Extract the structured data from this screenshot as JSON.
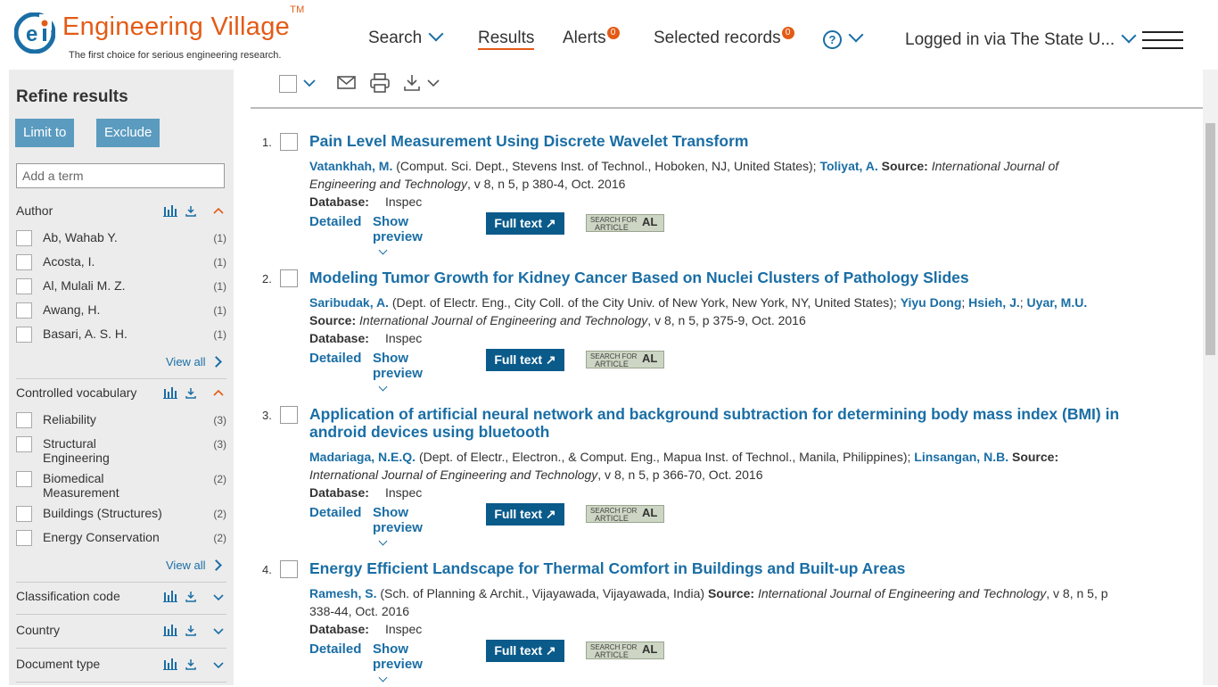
{
  "header": {
    "brand": "Engineering Village",
    "trademark": "TM",
    "tagline": "The first choice for serious engineering research.",
    "nav": {
      "search": "Search",
      "results": "Results",
      "alerts": "Alerts",
      "alerts_count": "0",
      "selected": "Selected records",
      "selected_count": "0",
      "help": "?",
      "logged_in": "Logged in via The State U..."
    }
  },
  "sidebar": {
    "title": "Refine results",
    "limit_to": "Limit to",
    "exclude": "Exclude",
    "add_term_placeholder": "Add a term",
    "author": {
      "label": "Author",
      "items": [
        {
          "name": "Ab, Wahab Y.",
          "count": "(1)"
        },
        {
          "name": "Acosta, I.",
          "count": "(1)"
        },
        {
          "name": "Al, Mulali M. Z.",
          "count": "(1)"
        },
        {
          "name": "Awang, H.",
          "count": "(1)"
        },
        {
          "name": "Basari, A. S. H.",
          "count": "(1)"
        }
      ],
      "view_all": "View all"
    },
    "controlled_vocabulary": {
      "label": "Controlled vocabulary",
      "items": [
        {
          "name": "Reliability",
          "count": "(3)"
        },
        {
          "name": "Structural Engineering",
          "count": "(3)"
        },
        {
          "name": "Biomedical Measurement",
          "count": "(2)"
        },
        {
          "name": "Buildings (Structures)",
          "count": "(2)"
        },
        {
          "name": "Energy Conservation",
          "count": "(2)"
        }
      ],
      "view_all": "View all"
    },
    "classification_code": "Classification code",
    "country": "Country",
    "document_type": "Document type"
  },
  "results": [
    {
      "num": "1.",
      "title": "Pain Level Measurement Using Discrete Wavelet Transform",
      "author1": "Vatankhah, M.",
      "affil1": "(Comput. Sci. Dept., Stevens Inst. of Technol., Hoboken, NJ, United States);",
      "author2": "Toliyat, A.",
      "source_label": "Source:",
      "journal": "International Journal of Engineering and Technology",
      "details": ", v 8, n 5, p 380-4, Oct. 2016",
      "db_label": "Database:",
      "db": "Inspec"
    },
    {
      "num": "2.",
      "title": "Modeling Tumor Growth for Kidney Cancer Based on Nuclei Clusters of Pathology Slides",
      "author1": "Saribudak, A.",
      "affil1": "(Dept. of Electr. Eng., City Coll. of the City Univ. of New York, New York, NY, United States);",
      "author2": "Yiyu Dong",
      "author3": "Hsieh, J.",
      "author4": "Uyar, M.U.",
      "source_label": "Source:",
      "journal": "International Journal of Engineering and Technology",
      "details": ", v 8, n 5, p 375-9, Oct. 2016",
      "db_label": "Database:",
      "db": "Inspec"
    },
    {
      "num": "3.",
      "title": "Application of artificial neural network and background subtraction for determining body mass index (BMI) in android devices using bluetooth",
      "author1": "Madariaga, N.E.Q.",
      "affil1": "(Dept. of Electr., Electron., & Comput. Eng., Mapua Inst. of Technol., Manila, Philippines);",
      "author2": "Linsangan, N.B.",
      "source_label": "Source:",
      "journal": "International Journal of Engineering and Technology",
      "details": ", v 8, n 5, p 366-70, Oct. 2016",
      "db_label": "Database:",
      "db": "Inspec"
    },
    {
      "num": "4.",
      "title": "Energy Efficient Landscape for Thermal Comfort in Buildings and Built-up Areas",
      "author1": "Ramesh, S.",
      "affil1": "(Sch. of Planning & Archit., Vijayawada, Vijayawada, India)",
      "source_label": "Source:",
      "journal": "International Journal of Engineering and Technology",
      "details": ", v 8, n 5, p 338-44, Oct. 2016",
      "db_label": "Database:",
      "db": "Inspec"
    }
  ],
  "actions": {
    "detailed": "Detailed",
    "show_preview": "Show preview",
    "full_text": "Full text",
    "sfa_line1": "SEARCH FOR",
    "sfa_line2": "ARTICLE",
    "sfa_logo": "AL"
  }
}
